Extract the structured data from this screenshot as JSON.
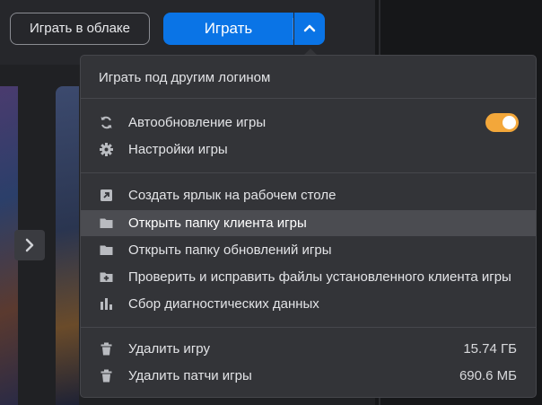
{
  "header": {
    "cloud_button": "Играть в облаке",
    "play_button": "Играть"
  },
  "menu": {
    "login_item": "Играть под другим логином",
    "auto_update": {
      "label": "Автообновление игры",
      "enabled": true
    },
    "settings": "Настройки игры",
    "create_shortcut": "Создать ярлык на рабочем столе",
    "open_client_folder": "Открыть папку клиента игры",
    "open_updates_folder": "Открыть папку обновлений игры",
    "verify_files": "Проверить и исправить файлы установленного клиента игры",
    "diagnostics": "Сбор диагностических данных",
    "delete_game": {
      "label": "Удалить игру",
      "size": "15.74 ГБ"
    },
    "delete_patches": {
      "label": "Удалить патчи игры",
      "size": "690.6 МБ"
    }
  },
  "colors": {
    "accent_blue": "#0a74e6",
    "toggle_orange": "#f3a73a",
    "menu_bg": "#333438",
    "hover_bg": "#4b4c51"
  },
  "icons": {
    "auto_update": "refresh-icon",
    "settings": "gear-icon",
    "create_shortcut": "shortcut-icon",
    "open_client_folder": "folder-icon",
    "open_updates_folder": "folder-icon",
    "verify_files": "folder-plus-icon",
    "diagnostics": "bar-chart-icon",
    "delete_game": "trash-icon",
    "delete_patches": "trash-icon",
    "dropdown": "chevron-up-icon",
    "carousel": "chevron-right-icon"
  }
}
